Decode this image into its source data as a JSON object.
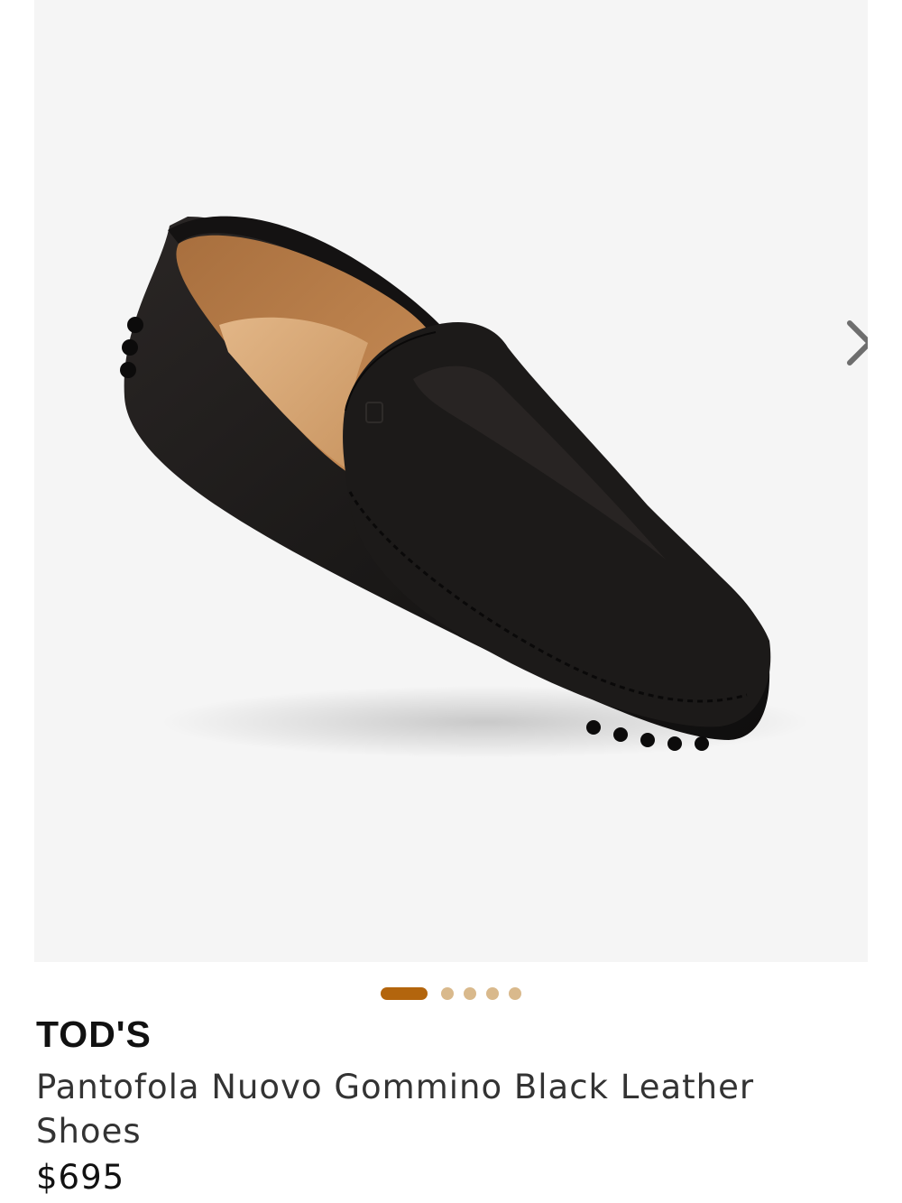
{
  "product": {
    "brand": "TOD'S",
    "name": "Pantofola Nuovo Gommino Black Leather Shoes",
    "price": "$695"
  },
  "gallery": {
    "image_subject": "black leather driving loafer",
    "next_icon": "chevron-right-icon",
    "dot_count": 5,
    "active_index": 0
  },
  "colors": {
    "accent_active_dot": "#b3650d",
    "inactive_dot": "#d9b98c",
    "gallery_background": "#f5f5f5"
  }
}
